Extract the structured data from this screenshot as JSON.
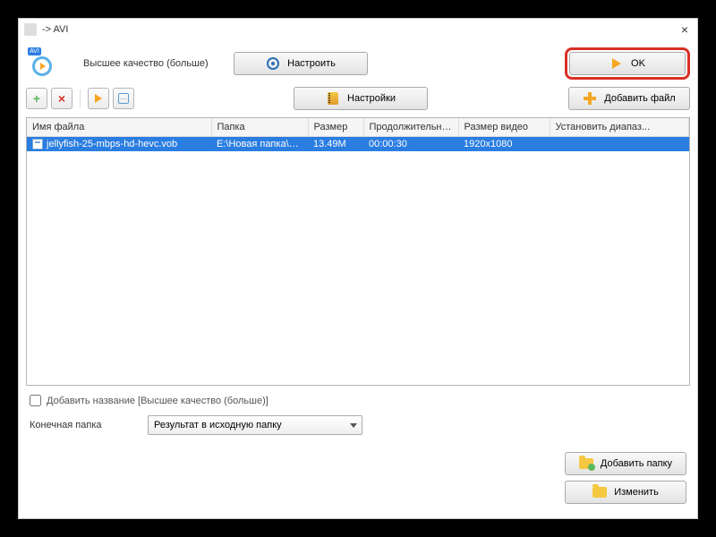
{
  "titlebar": {
    "title": " -> AVI",
    "close": "×"
  },
  "top": {
    "avi_badge": "AVI",
    "quality_label": "Высшее качество (больше)",
    "configure_btn": "Настроить",
    "ok_btn": "OK",
    "settings_btn": "Настройки",
    "add_file_btn": "Добавить файл"
  },
  "table": {
    "headers": {
      "filename": "Имя файла",
      "folder": "Папка",
      "size": "Размер",
      "duration": "Продолжительность",
      "video_size": "Размер видео",
      "range": "Установить диапаз..."
    },
    "rows": [
      {
        "filename": "jellyfish-25-mbps-hd-hevc.vob",
        "folder": "E:\\Новая папка\\FI...",
        "size": "13.49M",
        "duration": "00:00:30",
        "video_size": "1920x1080",
        "range": ""
      }
    ]
  },
  "bottom": {
    "checkbox_label": "Добавить название [Высшее качество (больше)]",
    "output_folder_label": "Конечная папка",
    "select_value": "Результат в исходную папку",
    "add_folder_btn": "Добавить папку",
    "change_btn": "Изменить"
  }
}
